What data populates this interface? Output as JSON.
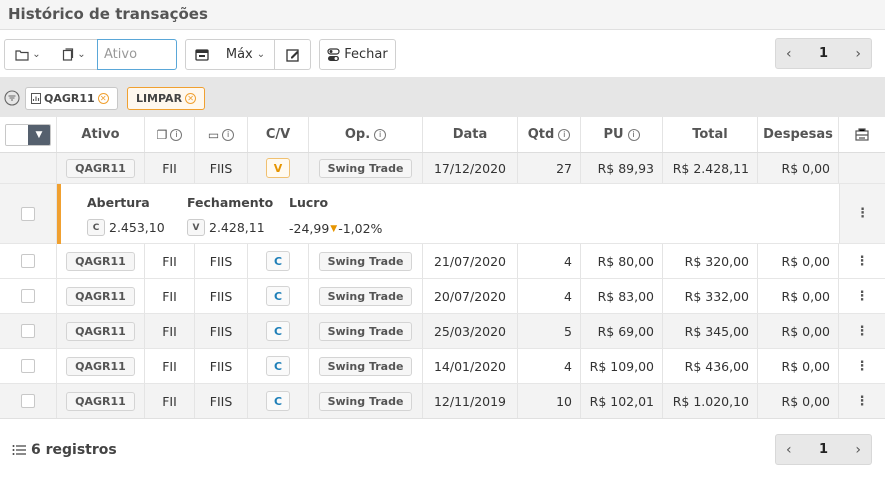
{
  "title": "Histórico de transações",
  "toolbar": {
    "ativo_placeholder": "Ativo",
    "period_label": "Máx",
    "close_label": "Fechar",
    "page": "1"
  },
  "filters": {
    "asset_chip": "QAGR11",
    "clear_label": "LIMPAR"
  },
  "columns": {
    "ativo": "Ativo",
    "cv": "C/V",
    "op": "Op.",
    "data": "Data",
    "qtd": "Qtd",
    "pu": "PU",
    "total": "Total",
    "despesas": "Despesas"
  },
  "rows": [
    {
      "ativo": "QAGR11",
      "tipo": "FII",
      "seg": "FIIS",
      "cv": "V",
      "op": "Swing Trade",
      "data": "17/12/2020",
      "qtd": "27",
      "pu": "R$ 89,93",
      "total": "R$ 2.428,11",
      "despesas": "R$ 0,00"
    },
    {
      "ativo": "QAGR11",
      "tipo": "FII",
      "seg": "FIIS",
      "cv": "C",
      "op": "Swing Trade",
      "data": "21/07/2020",
      "qtd": "4",
      "pu": "R$ 80,00",
      "total": "R$ 320,00",
      "despesas": "R$ 0,00"
    },
    {
      "ativo": "QAGR11",
      "tipo": "FII",
      "seg": "FIIS",
      "cv": "C",
      "op": "Swing Trade",
      "data": "20/07/2020",
      "qtd": "4",
      "pu": "R$ 83,00",
      "total": "R$ 332,00",
      "despesas": "R$ 0,00"
    },
    {
      "ativo": "QAGR11",
      "tipo": "FII",
      "seg": "FIIS",
      "cv": "C",
      "op": "Swing Trade",
      "data": "25/03/2020",
      "qtd": "5",
      "pu": "R$ 69,00",
      "total": "R$ 345,00",
      "despesas": "R$ 0,00"
    },
    {
      "ativo": "QAGR11",
      "tipo": "FII",
      "seg": "FIIS",
      "cv": "C",
      "op": "Swing Trade",
      "data": "14/01/2020",
      "qtd": "4",
      "pu": "R$ 109,00",
      "total": "R$ 436,00",
      "despesas": "R$ 0,00"
    },
    {
      "ativo": "QAGR11",
      "tipo": "FII",
      "seg": "FIIS",
      "cv": "C",
      "op": "Swing Trade",
      "data": "12/11/2019",
      "qtd": "10",
      "pu": "R$ 102,01",
      "total": "R$ 1.020,10",
      "despesas": "R$ 0,00"
    }
  ],
  "detail": {
    "abertura_label": "Abertura",
    "fechamento_label": "Fechamento",
    "lucro_label": "Lucro",
    "abertura_tag": "C",
    "abertura_value": "2.453,10",
    "fechamento_tag": "V",
    "fechamento_value": "2.428,11",
    "lucro_value": "-24,99",
    "lucro_pct": "-1,02%"
  },
  "footer": {
    "count_label": "6 registros",
    "page": "1"
  },
  "colors": {
    "accent": "#f0a030",
    "link": "#1e7fb8"
  }
}
